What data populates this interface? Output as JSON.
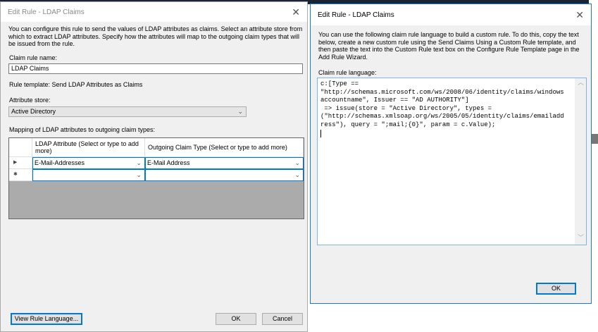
{
  "main_dialog": {
    "title": "Edit Rule - LDAP Claims",
    "description": "You can configure this rule to send the values of LDAP attributes as claims. Select an attribute store from which to extract LDAP attributes. Specify how the attributes will map to the outgoing claim types that will be issued from the rule.",
    "claim_rule_name_label": "Claim rule name:",
    "claim_rule_name_value": "LDAP Claims",
    "rule_template": "Rule template: Send LDAP Attributes as Claims",
    "attribute_store_label": "Attribute store:",
    "attribute_store_value": "Active Directory",
    "mapping_label": "Mapping of LDAP attributes to outgoing claim types:",
    "columns": [
      "LDAP Attribute (Select or type to add more)",
      "Outgoing Claim Type (Select or type to add more)"
    ],
    "rows": [
      {
        "marker": "▶",
        "ldap": "E-Mail-Addresses",
        "claim": "E-Mail Address"
      },
      {
        "marker": "✱",
        "ldap": "",
        "claim": ""
      }
    ],
    "view_rule_language_label": "View Rule Language...",
    "ok_label": "OK",
    "cancel_label": "Cancel"
  },
  "rule_language_dialog": {
    "title": "Edit Rule - LDAP Claims",
    "description": "You can use the following claim rule language to build a custom rule. To do this, copy the text below, create a new custom rule using the Send Claims Using a Custom Rule template, and then paste the text into the Custom Rule text box on the Configure Rule Template page in the Add Rule Wizard.",
    "claim_rule_language_label": "Claim rule language:",
    "code": "c:[Type ==\n\"http://schemas.microsoft.com/ws/2008/06/identity/claims/windows\naccountname\", Issuer == \"AD AUTHORITY\"]\n => issue(store = \"Active Directory\", types =\n(\"http://schemas.xmlsoap.org/ws/2005/05/identity/claims/emailadd\nress\"), query = \";mail;{0}\", param = c.Value);\n",
    "ok_label": "OK"
  }
}
